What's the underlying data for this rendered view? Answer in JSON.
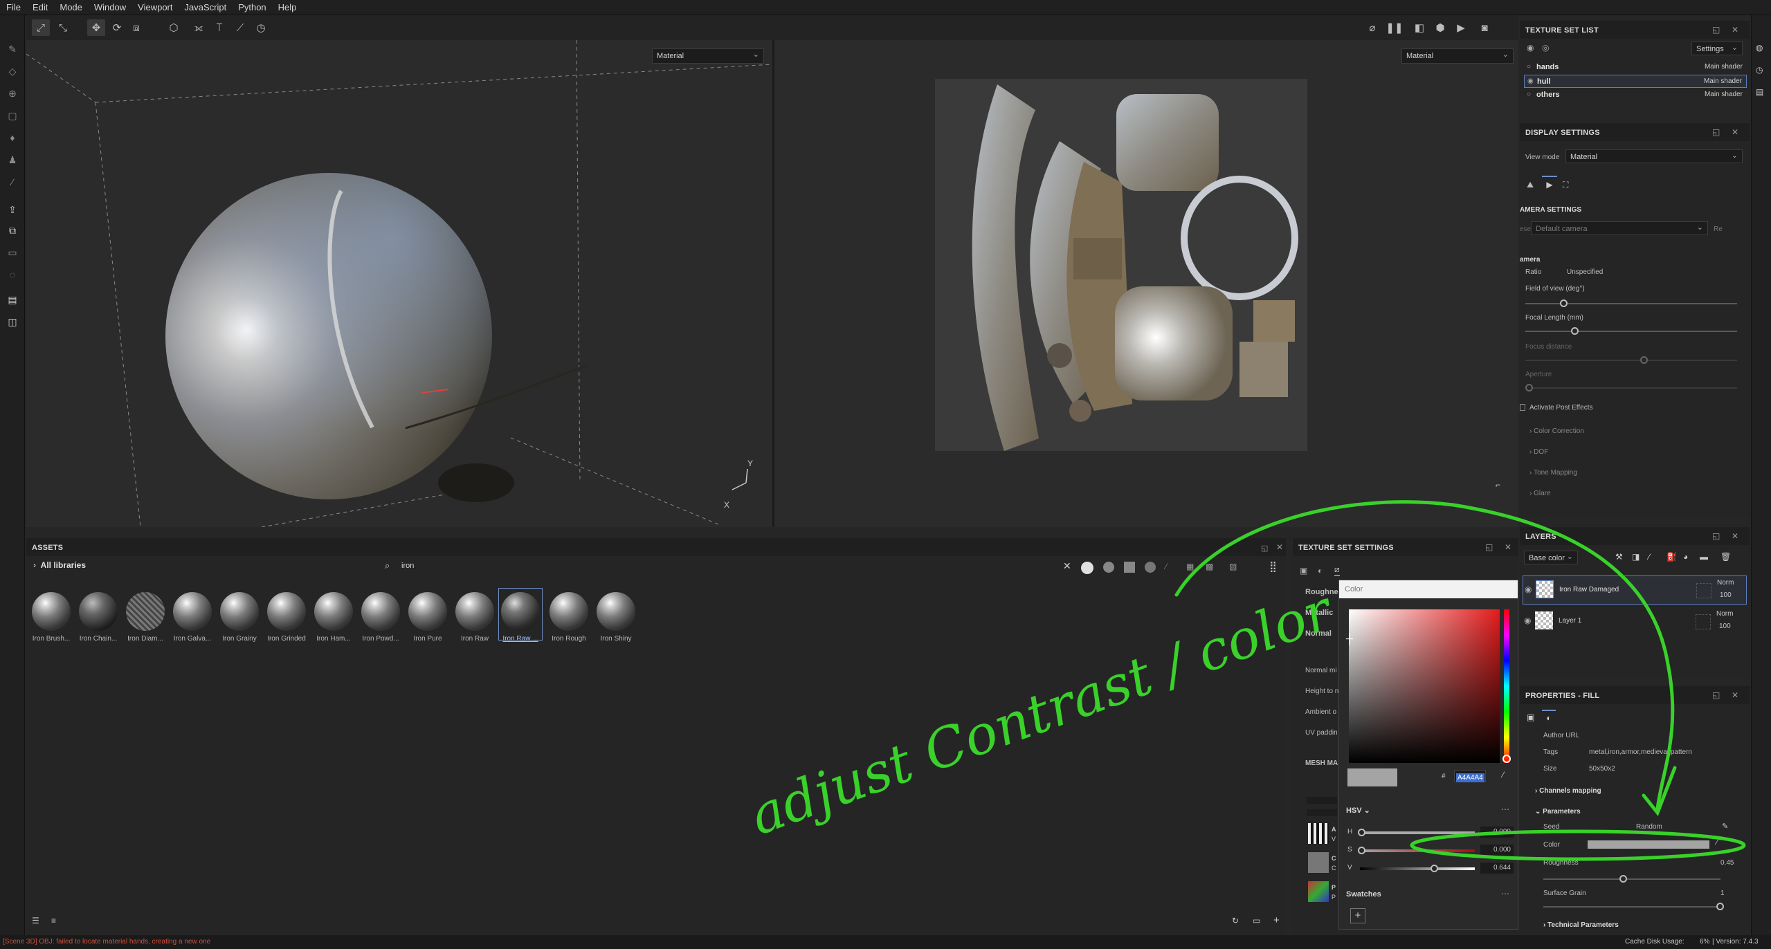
{
  "menu": [
    "File",
    "Edit",
    "Mode",
    "Window",
    "Viewport",
    "JavaScript",
    "Python",
    "Help"
  ],
  "viewport": {
    "left_mode": "Material",
    "right_mode": "Material"
  },
  "assets": {
    "title": "ASSETS",
    "library": "All libraries",
    "search": "iron",
    "items": [
      "Iron Brush...",
      "Iron Chain...",
      "Iron Diam...",
      "Iron Galva...",
      "Iron Grainy",
      "Iron Grinded",
      "Iron Ham...",
      "Iron Powd...",
      "Iron Pure",
      "Iron Raw",
      "Iron Raw ...",
      "Iron Rough",
      "Iron Shiny"
    ],
    "selected_index": 10
  },
  "texture_set_settings": {
    "title": "TEXTURE SET SETTINGS",
    "rows": [
      "Roughne",
      "Metallic",
      "Normal"
    ],
    "rows2": [
      "Normal mi",
      "Height to n",
      "Ambient o",
      "UV paddin"
    ],
    "mesh": "MESH MA",
    "map_items": [
      "A",
      "V",
      "C",
      "C",
      "P",
      "P"
    ]
  },
  "color_picker": {
    "title": "Color",
    "hex_label": "#",
    "hex": "A4A4A4",
    "mode": "HSV",
    "h_label": "H",
    "h": "0.000",
    "s_label": "S",
    "s": "0.000",
    "v_label": "V",
    "v": "0.644",
    "swatches": "Swatches",
    "add": "+",
    "value_level": 0.644
  },
  "texture_set_list": {
    "title": "TEXTURE SET LIST",
    "settings": "Settings",
    "sets": [
      {
        "name": "hands",
        "shader": "Main shader"
      },
      {
        "name": "hull",
        "shader": "Main shader"
      },
      {
        "name": "others",
        "shader": "Main shader"
      }
    ]
  },
  "display_settings": {
    "title": "DISPLAY SETTINGS",
    "view_mode_label": "View mode",
    "view_mode": "Material",
    "camera_settings": "AMERA SETTINGS",
    "preset_label": "eset",
    "preset": "Default camera",
    "re": "Re",
    "camera": "amera",
    "ratio_label": "Ratio",
    "ratio": "Unspecified",
    "fov": "Field of view (deg°)",
    "focal": "Focal Length (mm)",
    "focus": "Focus distance",
    "aperture": "Aperture",
    "post": "Activate Post Effects",
    "sections": [
      "Color Correction",
      "DOF",
      "Tone Mapping",
      "Glare"
    ]
  },
  "layers": {
    "title": "LAYERS",
    "channel": "Base color",
    "items": [
      {
        "name": "Iron Raw Damaged",
        "blend": "Norm",
        "opacity": "100"
      },
      {
        "name": "Layer 1",
        "blend": "Norm",
        "opacity": "100"
      }
    ]
  },
  "properties": {
    "title": "PROPERTIES - FILL",
    "author": "Author URL",
    "tags_label": "Tags",
    "tags": "metal,iron,armor,medieval,pattern",
    "size_label": "Size",
    "size": "50x50x2",
    "channels": "Channels mapping",
    "parameters": "Parameters",
    "seed_label": "Seed",
    "seed": "Random",
    "color_label": "Color",
    "roughness_label": "Roughness",
    "roughness": "0.45",
    "grain_label": "Surface Grain",
    "grain": "1",
    "technical": "Technical Parameters"
  },
  "annotation": {
    "text": "adjust Contrast / color",
    "color": "#39d12a"
  },
  "status": {
    "error": "[Scene 3D] OBJ: failed to locate material hands, creating a new one",
    "cache": "Cache Disk Usage:",
    "cache_val": "6%",
    "version": "| Version: 7.4.3"
  }
}
